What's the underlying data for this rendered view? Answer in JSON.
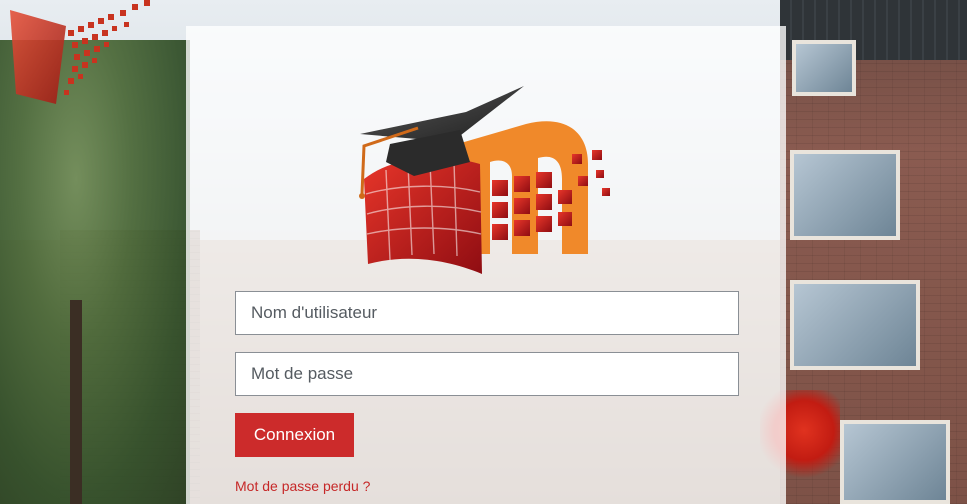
{
  "login": {
    "username_placeholder": "Nom d'utilisateur",
    "password_placeholder": "Mot de passe",
    "submit_label": "Connexion",
    "forgot_password_link": "Mot de passe perdu ?"
  },
  "colors": {
    "primary": "#cc2b2b",
    "link": "#c62828",
    "logo_orange": "#f0892a",
    "logo_red": "#c8141b"
  },
  "icons": {
    "logo": "moodle-graduation-cap-logo",
    "corner_logo": "pixel-cluster-logo"
  }
}
